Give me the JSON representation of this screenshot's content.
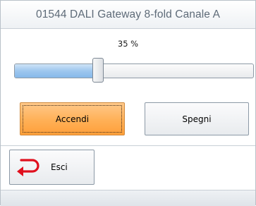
{
  "window": {
    "title": "01544 DALI Gateway 8-fold Canale A"
  },
  "dimmer": {
    "percent_label": "35 %",
    "level": 35
  },
  "buttons": {
    "on_label": "Accendi",
    "off_label": "Spegni",
    "exit_label": "Esci"
  },
  "icons": {
    "exit": "return-arrow-icon"
  },
  "colors": {
    "accent": "#FFB056",
    "fill": "#9EC7EE",
    "exit_icon": "#E0101E"
  }
}
